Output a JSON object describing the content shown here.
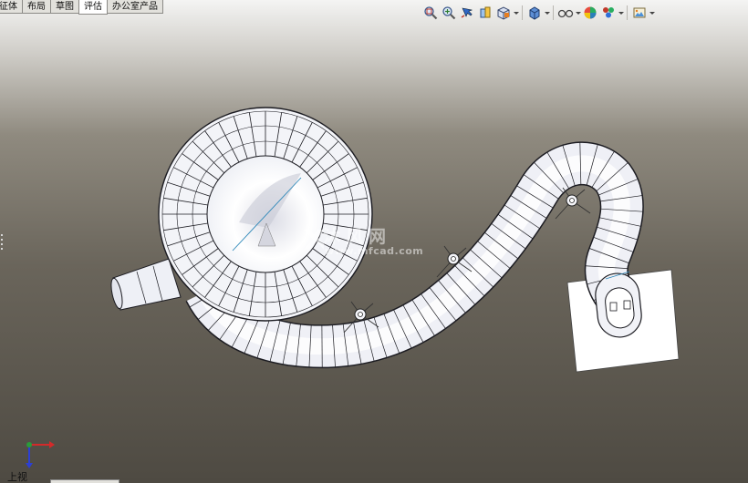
{
  "command_manager": {
    "tabs": [
      {
        "label": "特征体",
        "visible_label": "征体",
        "active": false
      },
      {
        "label": "布局",
        "visible_label": "布局",
        "active": false
      },
      {
        "label": "草图",
        "visible_label": "草图",
        "active": false
      },
      {
        "label": "评估",
        "visible_label": "评估",
        "active": true
      },
      {
        "label": "办公室产品",
        "visible_label": "办公室产品",
        "active": false
      }
    ]
  },
  "heads_up_toolbar": {
    "tools": [
      "zoom-to-fit-icon",
      "zoom-to-area-icon",
      "previous-view-icon",
      "section-view-icon",
      "view-orientation-icon",
      "display-style-icon",
      "hide-show-items-icon",
      "edit-appearance-icon",
      "apply-scene-icon",
      "view-settings-icon"
    ]
  },
  "watermark": {
    "cn": "沐风网",
    "url": "www.mfcad.com"
  },
  "view": {
    "label": "上视"
  },
  "triad": {
    "x_color": "#d32a2a",
    "y_color": "#2a9a3a",
    "z_color": "#2c3fd4"
  },
  "colors": {
    "model_fill": "#f0f1f6",
    "model_edges": "#1c1c22",
    "background_top": "#f4f4f3",
    "background_bottom": "#4e4a42"
  }
}
